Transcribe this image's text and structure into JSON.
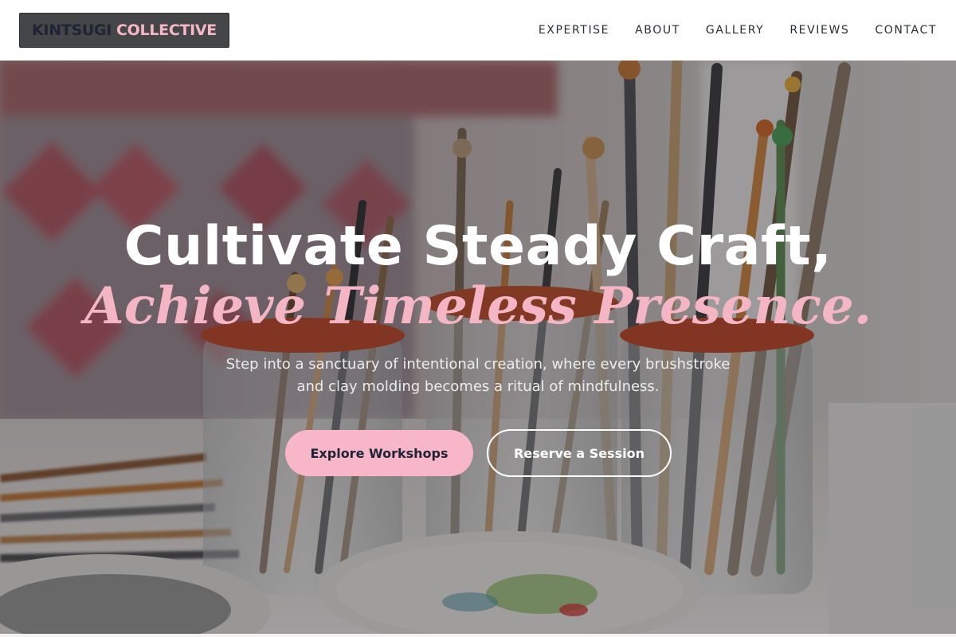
{
  "header": {
    "logo_part1": "KINTSUGI",
    "logo_part2": "COLLECTIVE",
    "nav": [
      {
        "label": "EXPERTISE"
      },
      {
        "label": "ABOUT"
      },
      {
        "label": "GALLERY"
      },
      {
        "label": "REVIEWS"
      },
      {
        "label": "CONTACT"
      }
    ]
  },
  "hero": {
    "headline_line1": "Cultivate Steady Craft,",
    "headline_line2": "Achieve Timeless Presence.",
    "subtext": "Step into a sanctuary of intentional creation, where every brushstroke and clay molding becomes a ritual of mindfulness.",
    "primary_button": "Explore Workshops",
    "secondary_button": "Reserve a Session",
    "background_image": "paintbrushes-in-glass-jars-image"
  },
  "colors": {
    "accent_pink": "#f7b7c8",
    "navy": "#1e2435",
    "logo_bg": "#454648"
  }
}
